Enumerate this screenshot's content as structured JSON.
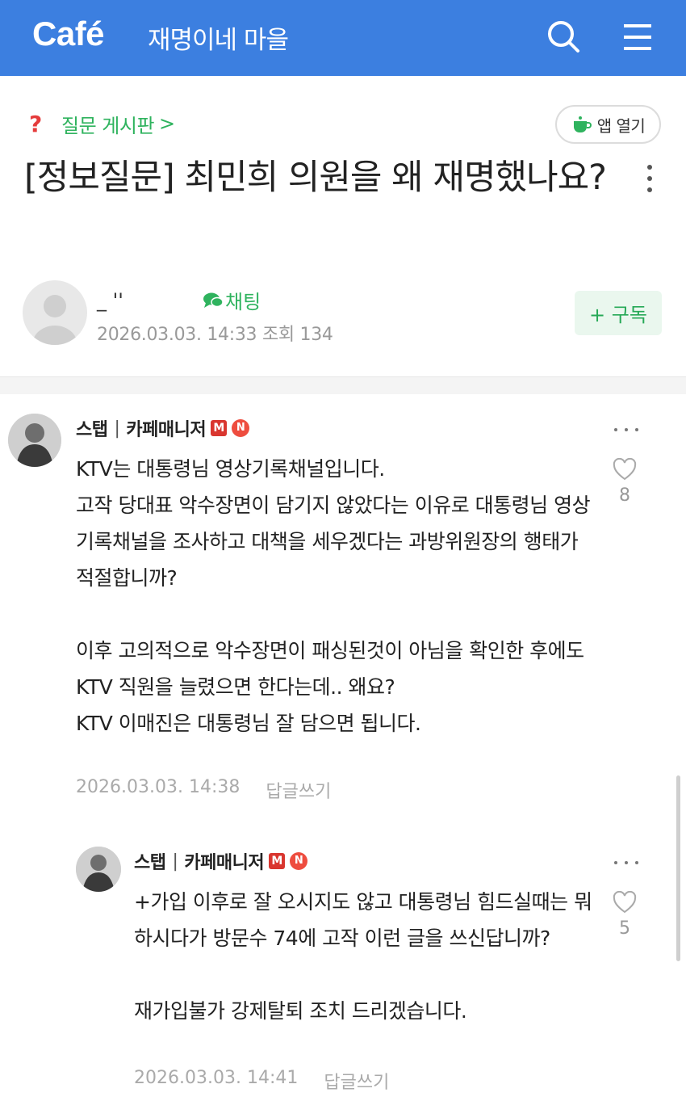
{
  "header": {
    "logo": "Café",
    "cafe_name": "재명이네 마을",
    "bg_color": "#3c7fe0"
  },
  "post": {
    "board_icon": "?",
    "board": "질문 게시판",
    "board_chevron": ">",
    "app_open_label": "앱 열기",
    "title": "[정보질문] 최민희 의원을 왜 재명했나요?",
    "author_name": "_ ''",
    "chat_label": "채팅",
    "date": "2026.03.03. 14:33",
    "views": "조회 134",
    "subscribe_label": "+ 구독"
  },
  "comments": [
    {
      "nickname": "스탭",
      "separator": "|",
      "role": "카페매니저",
      "badge_m": "M",
      "badge_n": "N",
      "text": "KTV는 대통령님 영상기록채널입니다.\n고작 당대표 악수장면이 담기지 않았다는 이유로 대통령님 영상기록채널을 조사하고 대책을 세우겠다는 과방위원장의 행태가 적절합니까?\n\n이후 고의적으로 악수장면이 패싱된것이 아님을 확인한 후에도\nKTV 직원을 늘렸으면 한다는데.. 왜요?\nKTV 이매진은 대통령님 잘 담으면 됩니다.",
      "date": "2026.03.03. 14:38",
      "reply_label": "답글쓰기",
      "likes": "8"
    },
    {
      "nickname": "스탭",
      "separator": "|",
      "role": "카페매니저",
      "badge_m": "M",
      "badge_n": "N",
      "text": "+가입 이후로 잘 오시지도 않고 대통령님 힘드실때는 뭐하시다가 방문수 74에 고작 이런 글을 쓰신답니까?\n\n재가입불가 강제탈퇴 조치 드리겠습니다.",
      "date": "2026.03.03. 14:41",
      "reply_label": "답글쓰기",
      "likes": "5"
    }
  ],
  "colors": {
    "accent_green": "#2fb35e",
    "question_red": "#e53c3c",
    "badge_red": "#d9362f"
  }
}
